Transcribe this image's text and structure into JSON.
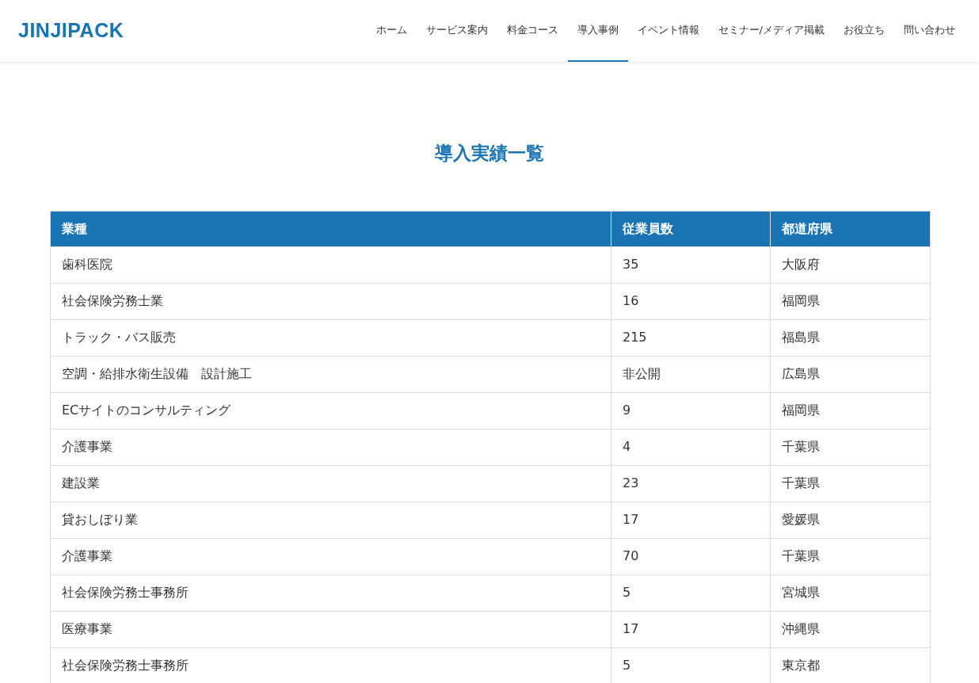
{
  "header": {
    "logo": "JINJIPACK",
    "nav": [
      {
        "label": "ホーム",
        "selected": false
      },
      {
        "label": "サービス案内",
        "selected": false
      },
      {
        "label": "料金コース",
        "selected": false
      },
      {
        "label": "導入事例",
        "selected": true
      },
      {
        "label": "イベント情報",
        "selected": false
      },
      {
        "label": "セミナー/メディア掲載",
        "selected": false
      },
      {
        "label": "お役立ち",
        "selected": false
      },
      {
        "label": "問い合わせ",
        "selected": false
      }
    ]
  },
  "title": "導入実績一覧",
  "table": {
    "columns": [
      "業種",
      "従業員数",
      "都道府県"
    ],
    "rows": [
      [
        "歯科医院",
        "35",
        "大阪府"
      ],
      [
        "社会保険労務士業",
        "16",
        "福岡県"
      ],
      [
        "トラック・バス販売",
        "215",
        "福島県"
      ],
      [
        "空調・給排水衛生設備　設計施工",
        "非公開",
        "広島県"
      ],
      [
        "ECサイトのコンサルティング",
        "9",
        "福岡県"
      ],
      [
        "介護事業",
        "4",
        "千葉県"
      ],
      [
        "建設業",
        "23",
        "千葉県"
      ],
      [
        "貸おしぼり業",
        "17",
        "愛媛県"
      ],
      [
        "介護事業",
        "70",
        "千葉県"
      ],
      [
        "社会保険労務士事務所",
        "5",
        "宮城県"
      ],
      [
        "医療事業",
        "17",
        "沖縄県"
      ],
      [
        "社会保険労務士事務所",
        "5",
        "東京都"
      ]
    ]
  }
}
